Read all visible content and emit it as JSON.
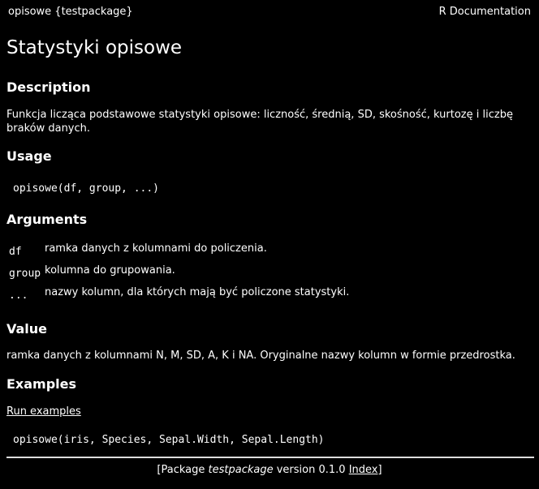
{
  "header": {
    "topic": "opisowe {testpackage}",
    "doc_label": "R Documentation"
  },
  "title": "Statystyki opisowe",
  "description": {
    "heading": "Description",
    "text": "Funkcja licząca podstawowe statystyki opisowe: liczność, średnią, SD, skośność, kurtozę i liczbę braków danych."
  },
  "usage": {
    "heading": "Usage",
    "code": "opisowe(df, group, ...)"
  },
  "arguments": {
    "heading": "Arguments",
    "items": [
      {
        "name": "df",
        "desc": "ramka danych z kolumnami do policzenia."
      },
      {
        "name": "group",
        "desc": "kolumna do grupowania."
      },
      {
        "name": "...",
        "desc": "nazwy kolumn, dla których mają być policzone statystyki."
      }
    ]
  },
  "value": {
    "heading": "Value",
    "text": "ramka danych z kolumnami N, M, SD, A, K i NA. Oryginalne nazwy kolumn w formie przedrostka."
  },
  "examples": {
    "heading": "Examples",
    "run_link": "Run examples",
    "code": "opisowe(iris, Species, Sepal.Width, Sepal.Length)"
  },
  "footer": {
    "prefix": "[Package ",
    "package": "testpackage",
    "version_text": " version 0.1.0 ",
    "index_link": "Index",
    "suffix": "]"
  }
}
